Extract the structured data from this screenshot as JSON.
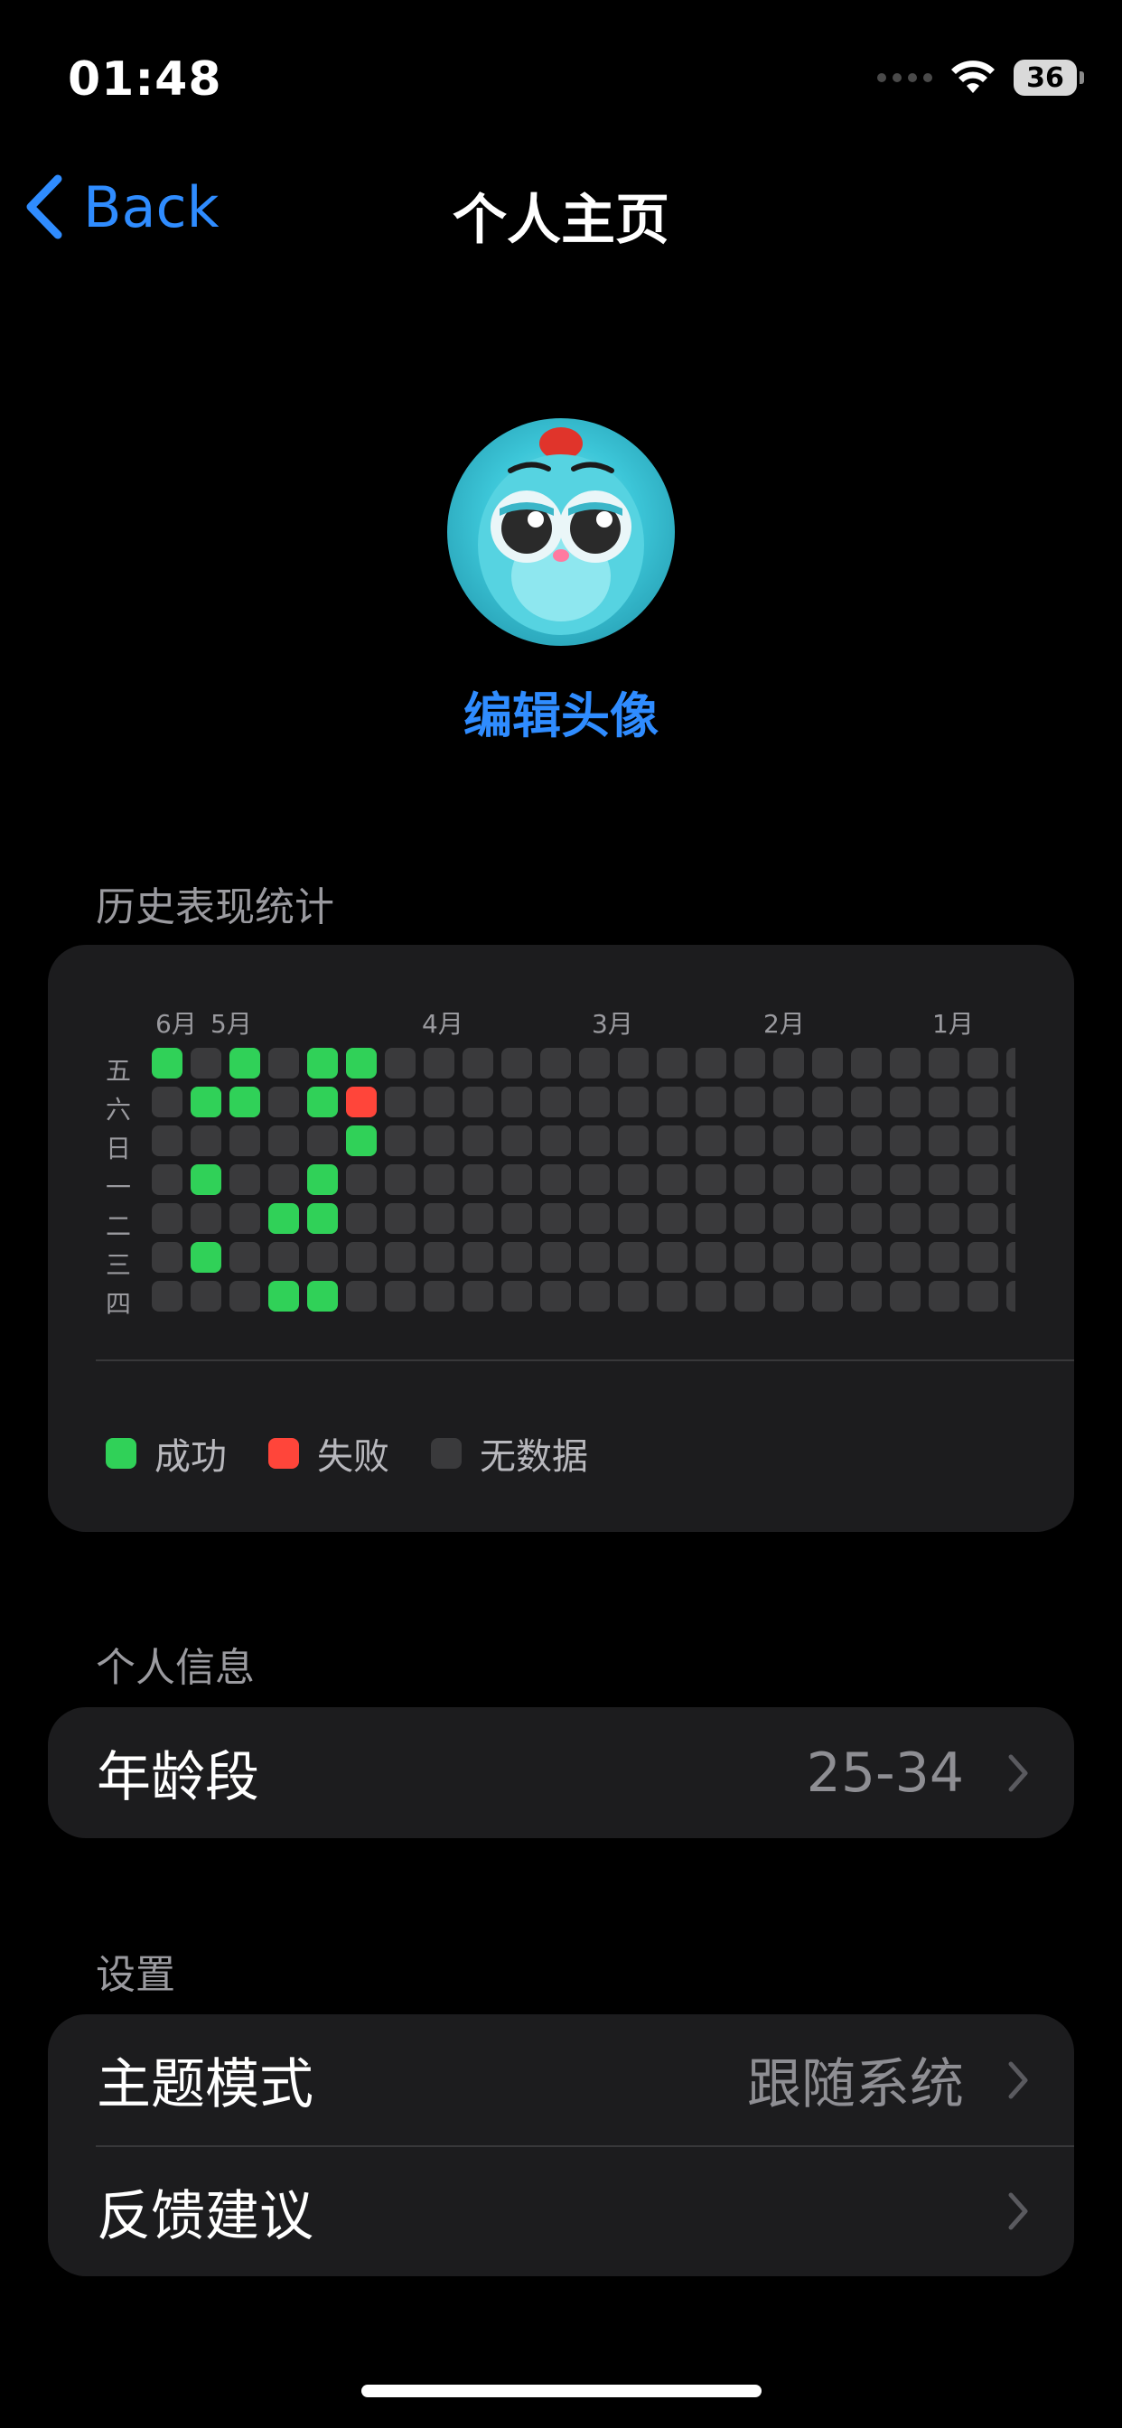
{
  "status_bar": {
    "time": "01:48",
    "battery": "36",
    "icons": [
      "cellular-icon",
      "wifi-icon",
      "battery-icon"
    ]
  },
  "nav": {
    "back_label": "Back",
    "title": "个人主页"
  },
  "avatar": {
    "edit_label": "编辑头像"
  },
  "stats": {
    "section_title": "历史表现统计",
    "month_labels": [
      "6月",
      "5月",
      "4月",
      "3月",
      "2月",
      "1月"
    ],
    "weekday_labels": [
      "五",
      "六",
      "日",
      "一",
      "二",
      "三",
      "四"
    ],
    "grid": [
      "SNSNSSNNNNNNNNNNNNNNNNN",
      "NSSNSFNNNNNNNNNNNNNNNNN",
      "NNNNNSNNNNNNNNNNNNNNNNN",
      "NSNNSNNNNNNNNNNNNNNNNNN",
      "NNNSSNNNNNNNNNNNNNNNNNN",
      "NSNNNNNNNNNNNNNNNNNNNNN",
      "NNNSSNNNNNNNNNNNNNNNNNN"
    ],
    "legend": [
      {
        "label": "成功",
        "color": "#30d158"
      },
      {
        "label": "失败",
        "color": "#ff453a"
      },
      {
        "label": "无数据",
        "color": "#3a3a3c"
      }
    ]
  },
  "profile": {
    "section_title": "个人信息",
    "age_label": "年龄段",
    "age_value": "25-34"
  },
  "settings": {
    "section_title": "设置",
    "theme_label": "主题模式",
    "theme_value": "跟随系统",
    "feedback_label": "反馈建议"
  },
  "colors": {
    "accent": "#2f8cff",
    "success": "#30d158",
    "failure": "#ff453a",
    "no_data": "#3a3a3c",
    "card_bg": "#1c1c1e"
  }
}
